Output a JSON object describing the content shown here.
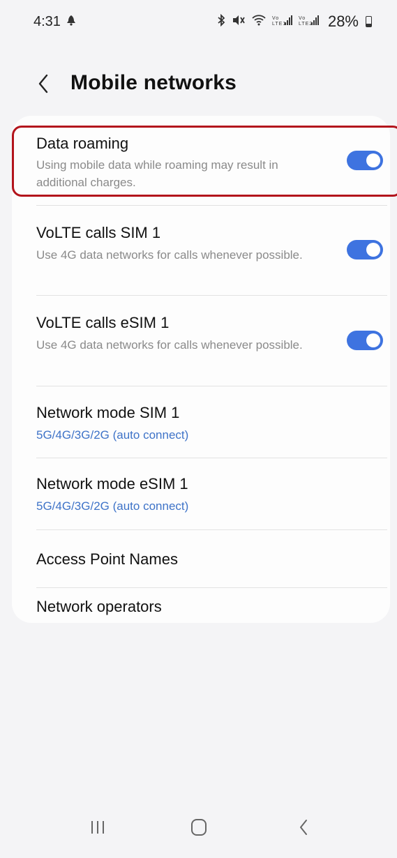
{
  "status_bar": {
    "time": "4:31",
    "left_icon": "notification-icon",
    "right_icons_text": "✻ ◀◀ ≋ .ıl .ıl",
    "battery_text": "28%"
  },
  "header": {
    "back_icon": "chevron-left-icon",
    "title": "Mobile networks"
  },
  "settings": {
    "data_roaming": {
      "title": "Data roaming",
      "description": "Using mobile data while roaming may result in additional charges.",
      "enabled": true
    },
    "volte_sim1": {
      "title": "VoLTE calls SIM 1",
      "description": "Use 4G data networks for calls whenever possible.",
      "enabled": true
    },
    "volte_esim1": {
      "title": "VoLTE calls eSIM 1",
      "description": "Use 4G data networks for calls whenever possible.",
      "enabled": true
    },
    "network_mode_sim1": {
      "title": "Network mode SIM 1",
      "value": "5G/4G/3G/2G (auto connect)"
    },
    "network_mode_esim1": {
      "title": "Network mode eSIM 1",
      "value": "5G/4G/3G/2G (auto connect)"
    },
    "access_point_names": {
      "title": "Access Point Names"
    },
    "network_operators": {
      "title": "Network operators"
    }
  },
  "colors": {
    "accent": "#3e73e0",
    "highlight": "#b3141c",
    "sub_text": "#3e73c8"
  },
  "nav_bar": {
    "recents_icon": "recents-icon",
    "home_icon": "home-icon",
    "back_icon": "back-icon"
  }
}
